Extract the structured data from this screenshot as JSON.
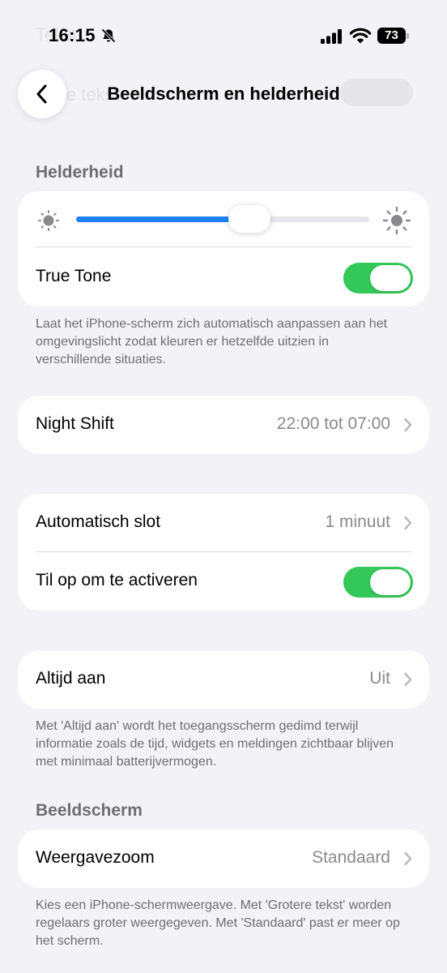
{
  "status": {
    "time": "16:15",
    "battery": "73"
  },
  "nav": {
    "title": "Beeldscherm en helderheid"
  },
  "brightness": {
    "header": "Helderheid",
    "level": 0.59,
    "true_tone_label": "True Tone",
    "true_tone_on": true,
    "footnote": "Laat het iPhone-scherm zich automatisch aanpassen aan het omgevingslicht zodat kleuren er hetzelfde uitzien in verschillende situaties."
  },
  "night_shift": {
    "label": "Night Shift",
    "value": "22:00 tot 07:00"
  },
  "lock": {
    "auto_lock_label": "Automatisch slot",
    "auto_lock_value": "1 minuut",
    "raise_to_wake_label": "Til op om te activeren",
    "raise_to_wake_on": true
  },
  "always_on": {
    "label": "Altijd aan",
    "value": "Uit",
    "footnote": "Met 'Altijd aan' wordt het toegangsscherm gedimd terwijl informatie zoals de tijd, widgets en meldingen zichtbaar blijven met minimaal batterijvermogen."
  },
  "display": {
    "header": "Beeldscherm",
    "zoom_label": "Weergavezoom",
    "zoom_value": "Standaard",
    "footnote": "Kies een iPhone-schermweergave. Met 'Grotere tekst' worden regelaars groter weergegeven. Met 'Standaard' past er meer op het scherm."
  },
  "colors": {
    "accent": "#1e82f5",
    "toggle_on": "#34c759"
  }
}
